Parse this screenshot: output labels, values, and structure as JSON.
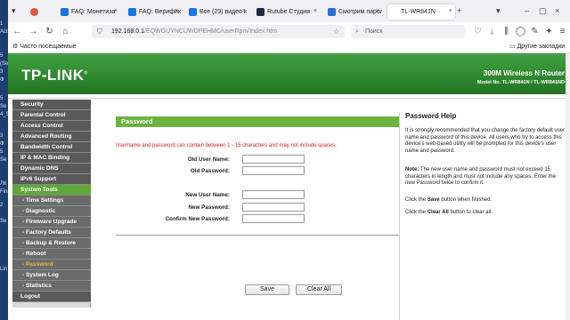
{
  "desktop": {
    "labels": [
      "1",
      "Acti",
      "5",
      "(Se",
      "3",
      "Ф",
      "5",
      "Se",
      "4_Se",
      "3",
      "Ф",
      "5",
      "Se",
      "ЛК",
      "Fina",
      "2",
      "Se",
      "Lin"
    ]
  },
  "browser": {
    "tabs": [
      {
        "label": "",
        "icon_color": "#e0533b",
        "icon": "record-icon",
        "active": false
      },
      {
        "label": "FAQ: Монетиза",
        "icon_color": "#1a73e8",
        "icon": "vk-icon",
        "active": false
      },
      {
        "label": "FAQ: Верифика",
        "icon_color": "#1a73e8",
        "icon": "vk-icon",
        "active": false
      },
      {
        "label": "Все (29) видео к",
        "icon_color": "#1a73e8",
        "icon": "vk-icon",
        "active": false
      },
      {
        "label": "Rutube Студия",
        "icon_color": "#1f2a44",
        "icon": "rutube-icon",
        "active": false
      },
      {
        "label": "Смотрим парол",
        "icon_color": "#2c6fd4",
        "icon": "doc-icon",
        "active": false
      },
      {
        "label": "TL-WR841N",
        "icon_color": "#ffffff",
        "icon": "blank-icon",
        "active": true
      }
    ],
    "url": {
      "host": "192.168.0.1",
      "path": "/EQWGUYNCUWDPEHMC/userRpm/Index.htm"
    },
    "search_placeholder": "Поиск",
    "bookmarks": {
      "most_visited": "Часто посещаемые",
      "other": "Другие закладки"
    }
  },
  "router": {
    "brand": "TP-LINK",
    "brand_dot": "®",
    "product_name": "300M Wireless N Router",
    "model": "Model No. TL-WR841N / TL-WR841ND",
    "menu": [
      {
        "label": "Security",
        "kind": "main"
      },
      {
        "label": "Parental Control",
        "kind": "main"
      },
      {
        "label": "Access Control",
        "kind": "main"
      },
      {
        "label": "Advanced Routing",
        "kind": "main"
      },
      {
        "label": "Bandwidth Control",
        "kind": "main"
      },
      {
        "label": "IP & MAC Binding",
        "kind": "main"
      },
      {
        "label": "Dynamic DNS",
        "kind": "main"
      },
      {
        "label": "IPv6 Support",
        "kind": "main"
      },
      {
        "label": "System Tools",
        "kind": "selected"
      },
      {
        "label": "- Time Settings",
        "kind": "sub"
      },
      {
        "label": "- Diagnostic",
        "kind": "sub"
      },
      {
        "label": "- Firmware Upgrade",
        "kind": "sub"
      },
      {
        "label": "- Factory Defaults",
        "kind": "sub"
      },
      {
        "label": "- Backup & Restore",
        "kind": "sub"
      },
      {
        "label": "- Reboot",
        "kind": "sub"
      },
      {
        "label": "- Password",
        "kind": "subsel"
      },
      {
        "label": "- System Log",
        "kind": "sub"
      },
      {
        "label": "- Statistics",
        "kind": "sub"
      },
      {
        "label": "Logout",
        "kind": "main"
      }
    ],
    "form": {
      "title": "Password",
      "warning": "Username and password can contain between 1 - 15 characters and may not include spaces.",
      "old_user_name": "Old User Name:",
      "old_password": "Old Password:",
      "new_user_name": "New User Name:",
      "new_password": "New Password:",
      "confirm_password": "Confirm New Password:",
      "save": "Save",
      "clear_all": "Clear All"
    },
    "help": {
      "title": "Password Help",
      "p1": "It is strongly recommended that you change the factory default user name and password of this device. All users who try to access this device's web-based utility will be prompted for this device's user name and password.",
      "note_label": "Note:",
      "p2": "The new user name and password must not exceed 15 characters in length and must not include any spaces. Enter the new Password twice to confirm it.",
      "p3a": "Click the ",
      "p3b": "Save",
      "p3c": " button when finished.",
      "p4a": "Click the ",
      "p4b": "Clear All",
      "p4c": " button to clear all."
    }
  },
  "colors": {
    "header_green": "#2f8a2f",
    "title_green": "#6bb33f",
    "menu_selected": "#5ea83a",
    "menu_subselected_text": "#f2b43c",
    "warning_red": "#cc2222"
  }
}
